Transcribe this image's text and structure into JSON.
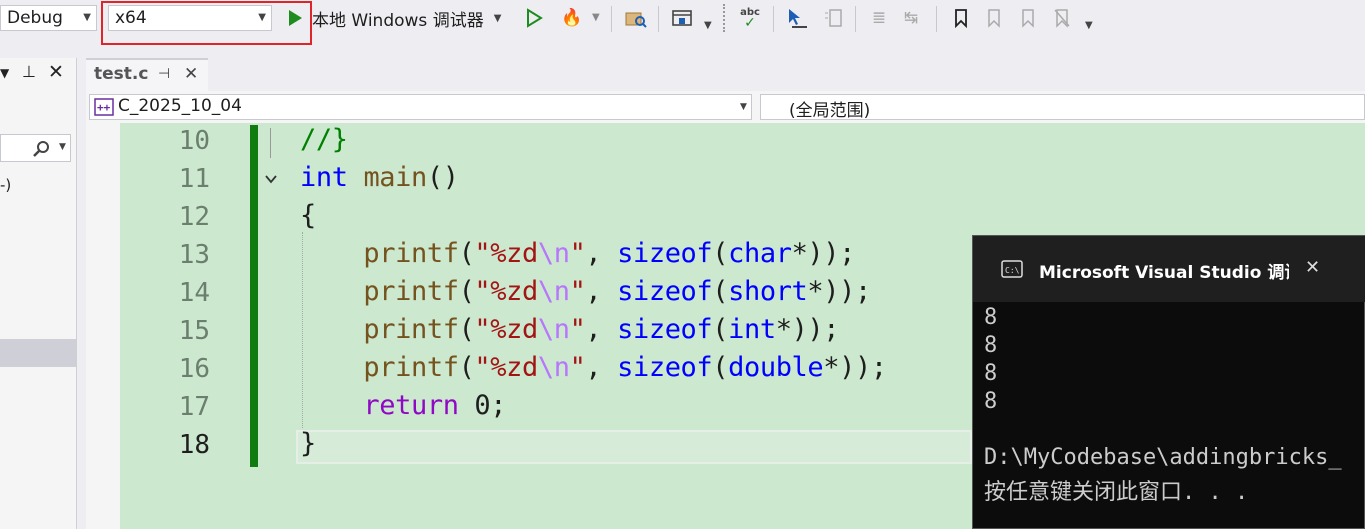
{
  "toolbar": {
    "config": "Debug",
    "platform": "x64",
    "run_label": "本地 Windows 调试器",
    "colors": {
      "highlight_box": "#e0252a",
      "run_green": "#1e8c1e"
    }
  },
  "left_panel": {
    "pin_glyph": " 📌",
    "close_glyph": "✕",
    "partial_text": "-)"
  },
  "tab": {
    "filename": "test.c",
    "pin_glyph": "⊣",
    "close_glyph": "✕"
  },
  "navbar": {
    "project": "C_2025_10_04",
    "scope": "(全局范围)"
  },
  "editor": {
    "line_numbers": [
      "10",
      "11",
      "12",
      "13",
      "14",
      "15",
      "16",
      "17",
      "18"
    ],
    "colors": {
      "background": "#cce8cf",
      "change_bar": "#107c10"
    }
  },
  "console": {
    "title": "Microsoft Visual Studio 调试控",
    "output": [
      "8",
      "8",
      "8",
      "8"
    ],
    "path_line": "D:\\MyCodebase\\addingbricks_",
    "prompt_line": "按任意键关闭此窗口. . ."
  }
}
